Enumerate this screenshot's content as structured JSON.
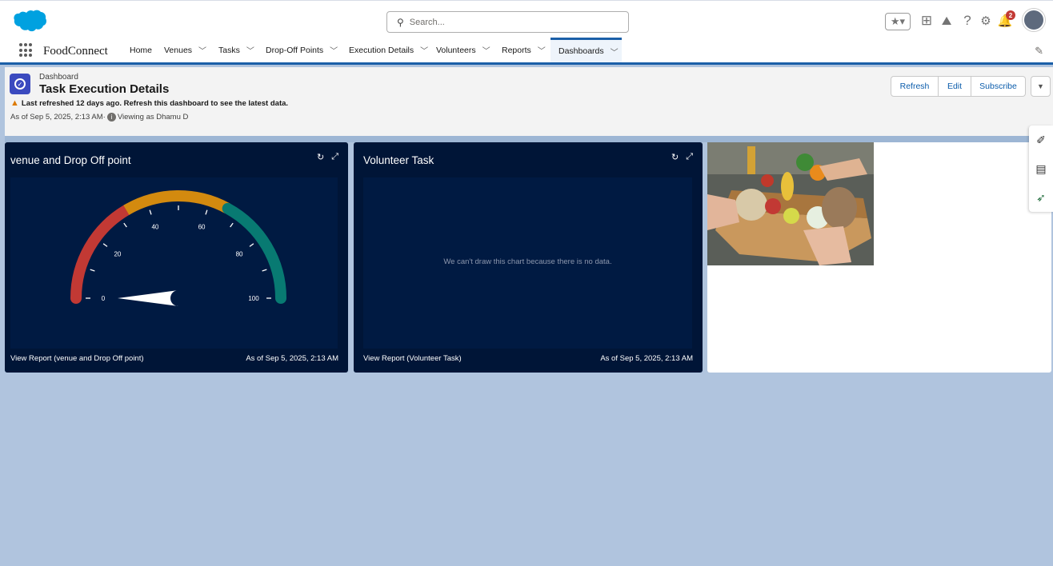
{
  "header": {
    "search_placeholder": "Search...",
    "notification_count": "2"
  },
  "nav": {
    "app_name": "FoodConnect",
    "items": [
      {
        "label": "Home",
        "has_menu": false
      },
      {
        "label": "Venues",
        "has_menu": true
      },
      {
        "label": "Tasks",
        "has_menu": true
      },
      {
        "label": "Drop-Off Points",
        "has_menu": true
      },
      {
        "label": "Execution Details",
        "has_menu": true
      },
      {
        "label": "Volunteers",
        "has_menu": true
      },
      {
        "label": "Reports",
        "has_menu": true
      },
      {
        "label": "Dashboards",
        "has_menu": true,
        "active": true
      }
    ]
  },
  "dashboard": {
    "type_label": "Dashboard",
    "title": "Task Execution Details",
    "warning": "Last refreshed 12 days ago. Refresh this dashboard to see the latest data.",
    "as_of": "As of Sep 5, 2025, 2:13 AM·",
    "viewing_as": "Viewing as Dhamu D",
    "buttons": {
      "refresh": "Refresh",
      "edit": "Edit",
      "subscribe": "Subscribe"
    }
  },
  "widgets": [
    {
      "title": "venue and Drop Off point",
      "footer_link": "View Report (venue and Drop Off point)",
      "footer_time": "As of Sep 5, 2025, 2:13 AM"
    },
    {
      "title": "Volunteer Task",
      "empty_message": "We can't draw this chart because there is no data.",
      "footer_link": "View Report (Volunteer Task)",
      "footer_time": "As of Sep 5, 2025, 2:13 AM"
    }
  ],
  "chart_data": {
    "type": "gauge",
    "min": 0,
    "max": 100,
    "value": 0,
    "tick_labels": [
      "0",
      "20",
      "40",
      "60",
      "80",
      "100"
    ],
    "bands": [
      {
        "from": 0,
        "to": 33,
        "color": "#c23934"
      },
      {
        "from": 33,
        "to": 66,
        "color": "#d38a0f"
      },
      {
        "from": 66,
        "to": 100,
        "color": "#087a72"
      }
    ]
  },
  "colors": {
    "brand_blue": "#1b5fa8",
    "widget_bg": "#001537",
    "page_bg": "#b0c4de"
  }
}
